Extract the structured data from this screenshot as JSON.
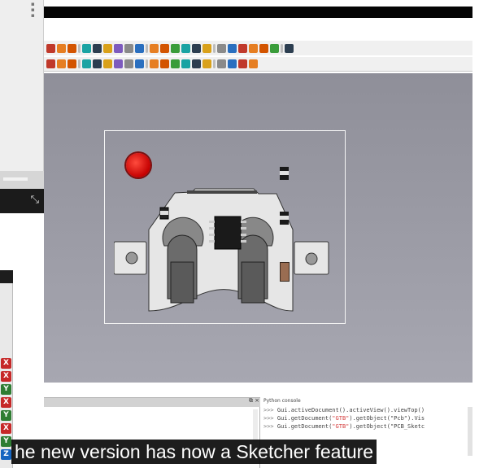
{
  "left_window": {
    "bottom_icon": "collapse-arrows-icon",
    "axis_buttons": [
      "X",
      "X",
      "Y",
      "X",
      "Y",
      "X",
      "Y",
      "Z"
    ]
  },
  "toolbar_row1_icons": [
    "box-icon",
    "cube-icon",
    "chart-icon",
    "pencil-icon",
    "filter-icon",
    "measure-icon",
    "dimension-icon",
    "move-icon",
    "rotate-icon",
    "palette-icon",
    "list-icon",
    "box-outline-icon",
    "select-icon",
    "zoom-icon",
    "record-icon",
    "view-iso-icon",
    "view-front-icon",
    "view-top-icon",
    "view-right-icon",
    "view-rear-icon",
    "view-bottom-icon",
    "view-left-icon",
    "measure-line-icon",
    "zoom-fit-icon",
    "part-icon",
    "spread-icon"
  ],
  "toolbar_row2_icons": [
    "pad-icon",
    "pocket-icon",
    "revolve-icon",
    "groove-icon",
    "loft-icon",
    "sweep-icon",
    "fillet-icon",
    "chamfer-icon",
    "draft-icon",
    "mirror-icon",
    "pattern-icon",
    "sketch-icon",
    "import-icon",
    "export-icon",
    "delete-icon",
    "assembly-icon",
    "library-icon",
    "component-icon",
    "wire-icon",
    "copper-icon",
    "drill-icon",
    "route-icon"
  ],
  "python_console": {
    "title": "Python console",
    "lines": [
      {
        "prompt": ">>>",
        "pre": "Gui.activeDocument().activeView().viewTop()",
        "str": "",
        "post": ""
      },
      {
        "prompt": ">>>",
        "pre": "Gui.getDocument(",
        "str": "\"GTB\"",
        "post": ").getObject(\"Pcb\").Vis"
      },
      {
        "prompt": ">>>",
        "pre": "Gui.getDocument(",
        "str": "\"GTB\"",
        "post": ").getObject(\"PCB_Sketc"
      }
    ]
  },
  "report_view": {
    "close_icon": "close-icon",
    "float_icon": "float-icon"
  },
  "caption": "he new version has now a Sketcher feature",
  "colors": {
    "viewport_top": "#8f8f99",
    "viewport_bottom": "#a7a7b1",
    "status_dot": "#d40000",
    "board": "#e6e6e6"
  }
}
